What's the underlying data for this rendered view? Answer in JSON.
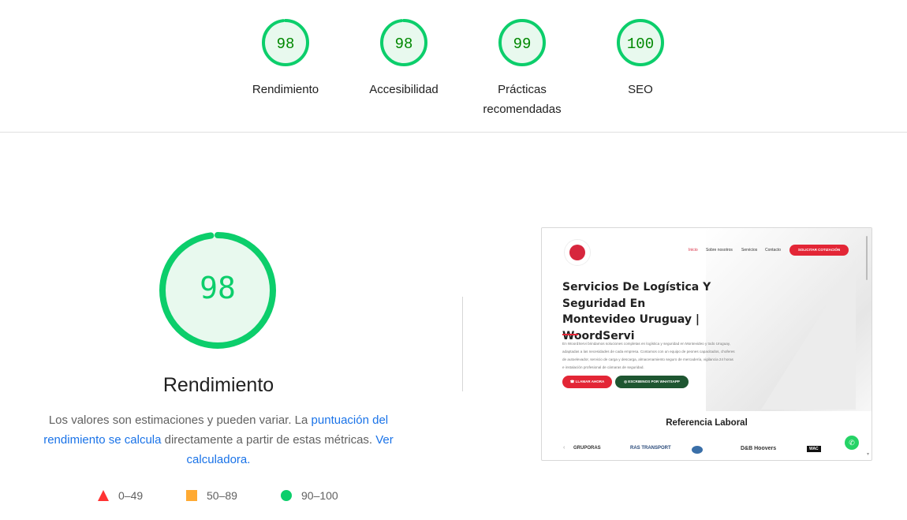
{
  "summary_gauges": [
    {
      "score": "98",
      "label": "Rendimiento"
    },
    {
      "score": "98",
      "label": "Accesibilidad"
    },
    {
      "score": "99",
      "label": "Prácticas recomendadas"
    },
    {
      "score": "100",
      "label": "SEO"
    }
  ],
  "performance": {
    "score": "98",
    "score_fraction": 0.98,
    "title": "Rendimiento",
    "desc_text_1": "Los valores son estimaciones y pueden variar. La ",
    "desc_link_1": "puntuación del rendimiento se calcula",
    "desc_text_2": " directamente a partir de estas métricas. ",
    "desc_link_2": "Ver calculadora.",
    "colors": {
      "pass": "#0cce6b",
      "pass_bg": "#e8f9ee",
      "average": "#ffaa33",
      "fail": "#ff3333"
    }
  },
  "legend": [
    {
      "range": "0–49",
      "icon": "fail-triangle-icon"
    },
    {
      "range": "50–89",
      "icon": "average-square-icon"
    },
    {
      "range": "90–100",
      "icon": "pass-circle-icon"
    }
  ],
  "screenshot": {
    "nav": [
      "Inicio",
      "Sobre nosotros",
      "Servicios",
      "Contacto"
    ],
    "cta": "SOLICITAR COTIZACIÓN",
    "headline": "Servicios De Logística Y Seguridad En Montevideo Uruguay | WoordServi",
    "paragraph": "En WoordServi brindamos soluciones completas en logística y seguridad en Montevideo y todo Uruguay, adaptadas a las necesidades de cada empresa. Contamos con un equipo de peones capacitados, choferes de autoelevador, servicio de carga y descarga, almacenamiento seguro de mercadería, vigilancia 24 horas e instalación profesional de cámaras de seguridad.",
    "btn_call": "LLAMAR AHORA",
    "btn_whatsapp": "ESCRIBINOS POR WHATSAPP",
    "section_title": "Referencia Laboral",
    "partner_logos": [
      "GRUPORAS",
      "RAS TRANSPORT",
      "",
      "D&B Hoovers",
      "WAC"
    ]
  }
}
